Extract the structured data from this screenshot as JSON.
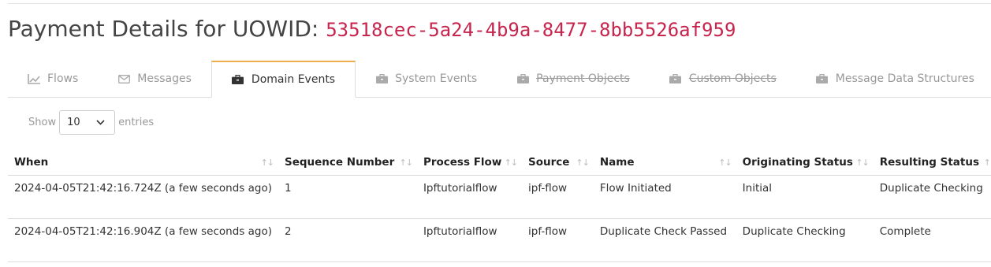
{
  "header": {
    "title": "Payment Details for UOWID:",
    "uowid": "53518cec-5a24-4b9a-8477-8bb5526af959"
  },
  "tabs": [
    {
      "label": "Flows",
      "icon": "chart-icon"
    },
    {
      "label": "Messages",
      "icon": "envelope-icon"
    },
    {
      "label": "Domain Events",
      "icon": "briefcase-icon"
    },
    {
      "label": "System Events",
      "icon": "briefcase-icon"
    },
    {
      "label": "Payment Objects",
      "icon": "briefcase-icon"
    },
    {
      "label": "Custom Objects",
      "icon": "briefcase-icon"
    },
    {
      "label": "Message Data Structures",
      "icon": "briefcase-icon"
    }
  ],
  "active_tab": "Domain Events",
  "length_control": {
    "show_label": "Show",
    "selected": "10",
    "entries_label": "entries"
  },
  "table": {
    "columns": [
      "When",
      "Sequence Number",
      "Process Flow",
      "Source",
      "Name",
      "Originating Status",
      "Resulting Status"
    ],
    "sort_glyph": "↑↓",
    "rows": [
      [
        "2024-04-05T21:42:16.724Z (a few seconds ago)",
        "1",
        "Ipftutorialflow",
        "ipf-flow",
        "Flow Initiated",
        "Initial",
        "Duplicate Checking"
      ],
      [
        "2024-04-05T21:42:16.904Z (a few seconds ago)",
        "2",
        "Ipftutorialflow",
        "ipf-flow",
        "Duplicate Check Passed",
        "Duplicate Checking",
        "Complete"
      ]
    ]
  },
  "colors": {
    "accent": "#f0ad4e",
    "uowid": "#c7254e",
    "muted": "#999999"
  }
}
